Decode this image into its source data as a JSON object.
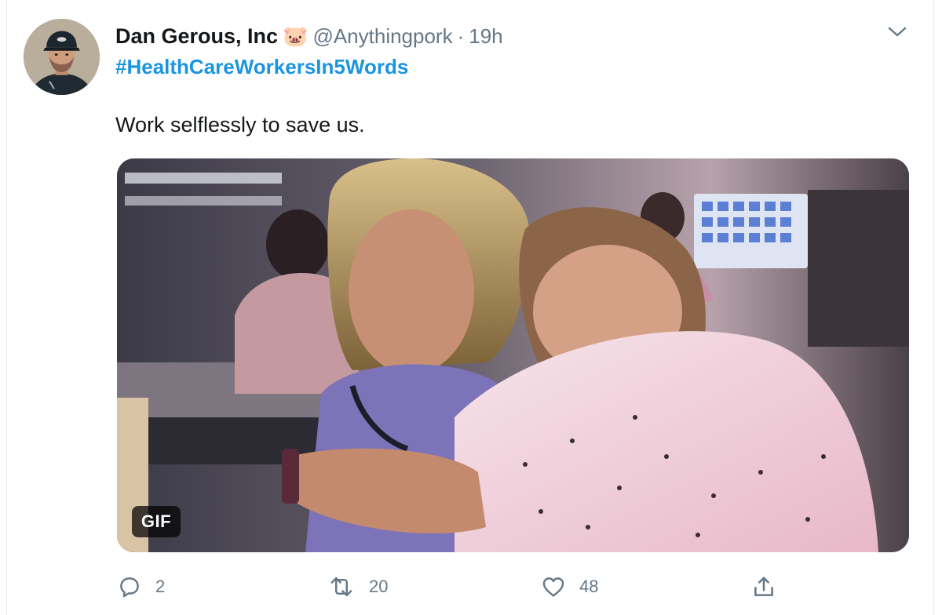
{
  "tweet": {
    "author": {
      "display_name": "Dan Gerous, Inc",
      "emoji": "🐷",
      "handle": "@Anythingpork",
      "separator": "·",
      "time": "19h"
    },
    "hashtag": "#HealthCareWorkersIn5Words",
    "text": "Work selflessly to save us.",
    "media": {
      "type": "gif",
      "badge_label": "GIF"
    },
    "actions": {
      "reply": {
        "icon": "reply-icon",
        "count": "2"
      },
      "retweet": {
        "icon": "retweet-icon",
        "count": "20"
      },
      "like": {
        "icon": "heart-icon",
        "count": "48"
      },
      "share": {
        "icon": "share-icon"
      }
    },
    "menu_icon": "chevron-down-icon"
  },
  "colors": {
    "link": "#1b95e0",
    "secondary_text": "#657786",
    "primary_text": "#14171a"
  }
}
